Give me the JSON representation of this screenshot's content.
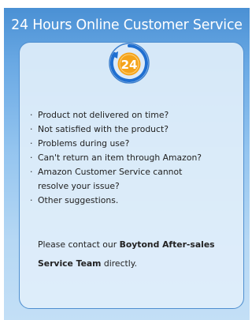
{
  "header": {
    "title": "24 Hours Online Customer Service"
  },
  "badge": {
    "number": "24",
    "icon": "24-hours-icon",
    "color_orange": "#f5a31a",
    "color_blue": "#1f6fd1"
  },
  "issues": [
    "Product not delivered on time?",
    "Not satisfied with the product?",
    "Problems during use?",
    "Can't return an item through Amazon?",
    "Amazon Customer Service cannot\nresolve your issue?",
    "Other suggestions."
  ],
  "contact": {
    "prefix": "Please contact our ",
    "team": "Boytond After-sales Service Team",
    "suffix": " directly."
  }
}
